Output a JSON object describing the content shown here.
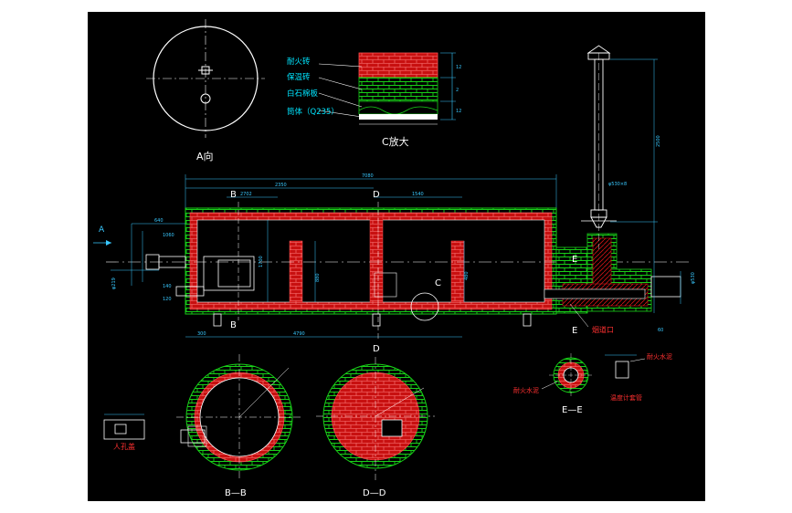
{
  "colors": {
    "background": "#000000",
    "frame": "#ffffff",
    "brick_red": "#d01414",
    "insulation_green": "#18d018",
    "dimension_cyan": "#38c8ff",
    "label_cyan": "#00e5ff",
    "label_red": "#ff3030",
    "yellow": "#e8e800"
  },
  "view_a": {
    "title": "A向"
  },
  "detail_c": {
    "title": "C放大",
    "layers": [
      {
        "label": "耐火砖"
      },
      {
        "label": "保温砖"
      },
      {
        "label": "白石棉板"
      },
      {
        "label": "筒体（Q235）"
      }
    ],
    "dims": [
      "12",
      "2",
      "12"
    ]
  },
  "elevation": {
    "section_marks": {
      "a_arrow": "A",
      "b_top": "B",
      "b_bottom": "B",
      "d_top": "D",
      "d_bottom": "D",
      "c_callout": "C",
      "e_top": "E",
      "e_bottom": "E"
    },
    "dims": {
      "overall": "7080",
      "left_span": "2350",
      "top_small_1": "2702",
      "top_small_2": "1540",
      "bottom_small": "4790",
      "bottom_left": "300",
      "stack_height": "2500",
      "stack_pipe": "φ530×8",
      "v1": "640",
      "v2": "1060",
      "v3": "1700",
      "v4": "880",
      "v5": "480",
      "v6": "120",
      "v7": "140",
      "v8": "60",
      "side_1": "φ219",
      "side_2": "φ530"
    },
    "port_label": "烟道口"
  },
  "section_bb": {
    "title": "B—B"
  },
  "section_dd": {
    "title": "D—D"
  },
  "manhole": {
    "label": "人孔盖"
  },
  "section_ee": {
    "title": "E—E",
    "labels": [
      "耐火水泥",
      "耐火水泥",
      "温度计套管"
    ]
  }
}
